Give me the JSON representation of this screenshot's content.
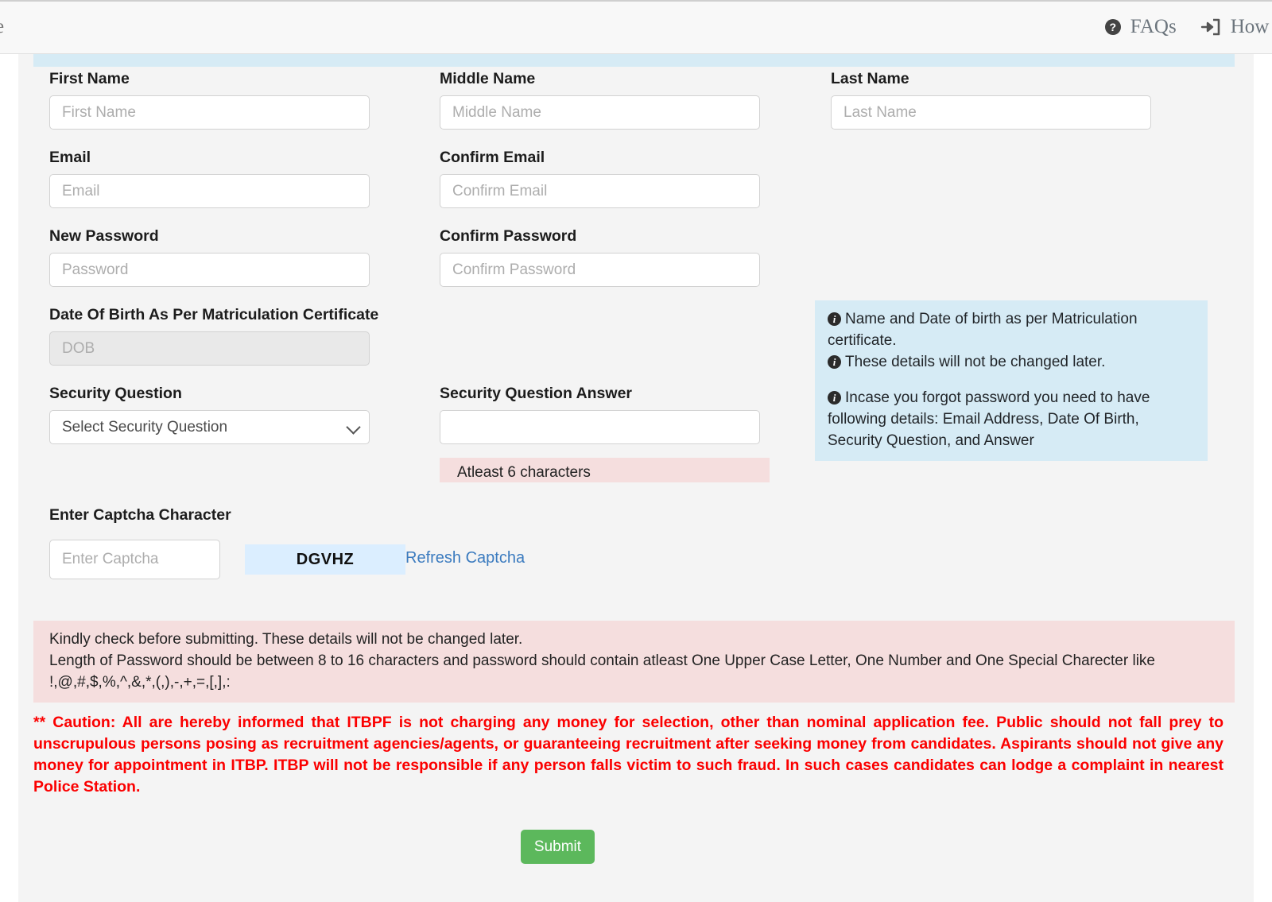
{
  "topbar": {
    "cut_text": "e",
    "links": [
      {
        "label": "FAQs",
        "icon": "question-circle-icon",
        "glyph": "?"
      },
      {
        "label": "How   to",
        "icon": "sign-in-icon",
        "glyph": ""
      }
    ]
  },
  "form": {
    "fields": [
      {
        "key": "first_name",
        "label": "First Name",
        "placeholder": "First Name",
        "value": "",
        "type": "text",
        "disabled": false
      },
      {
        "key": "middle_name",
        "label": "Middle Name",
        "placeholder": "Middle Name",
        "value": "",
        "type": "text",
        "disabled": false
      },
      {
        "key": "last_name",
        "label": "Last Name",
        "placeholder": "Last Name",
        "value": "",
        "type": "text",
        "disabled": false
      },
      {
        "key": "email",
        "label": "Email",
        "placeholder": "Email",
        "value": "",
        "type": "text",
        "disabled": false
      },
      {
        "key": "confirm_email",
        "label": "Confirm Email",
        "placeholder": "Confirm Email",
        "value": "",
        "type": "text",
        "disabled": false
      },
      {
        "key": "new_password",
        "label": "New Password",
        "placeholder": "Password",
        "value": "",
        "type": "password",
        "disabled": false
      },
      {
        "key": "confirm_password",
        "label": "Confirm Password",
        "placeholder": "Confirm Password",
        "value": "",
        "type": "password",
        "disabled": false
      },
      {
        "key": "dob",
        "label": "Date Of Birth As Per Matriculation Certificate",
        "placeholder": "DOB",
        "value": "",
        "type": "text",
        "disabled": true
      },
      {
        "key": "security_question",
        "label": "Security Question",
        "placeholder": "",
        "value": "Select Security Question",
        "type": "select",
        "disabled": false
      },
      {
        "key": "security_answer",
        "label": "Security Question Answer",
        "placeholder": "",
        "value": "",
        "type": "text",
        "disabled": false
      }
    ],
    "security_question_options": [
      "Select Security Question"
    ],
    "answer_hint": "Atleast 6 characters",
    "captcha_label": "Enter Captcha Character",
    "captcha_placeholder": "Enter Captcha",
    "captcha_value": "",
    "captcha_text": "DGVHZ",
    "refresh_captcha_label": "Refresh Captcha"
  },
  "info_boxes": [
    {
      "key": "name-dob-info",
      "lines": [
        "Name and Date of birth as per Matriculation certificate.",
        "These details will not be changed later."
      ]
    },
    {
      "key": "forgot-password-info",
      "lines": [
        "Incase you forgot password you need to have following details: Email Address, Date Of Birth, Security Question, and Answer"
      ]
    }
  ],
  "alerts": {
    "password_rules": [
      "Kindly check before submitting. These details will not be changed later.",
      "Length of Password should be between 8 to 16 characters and password should contain atleast One Upper Case Letter, One Number and One Special Charecter like",
      "!,@,#,$,%,^,&,*,(,),-,+,=,[,],:"
    ],
    "caution": "** Caution: All are hereby informed that ITBPF is not charging any money for selection, other than nominal application fee. Public should not fall prey to unscrupulous persons posing as recruitment agencies/agents, or guaranteeing recruitment after seeking money from candidates. Aspirants should not give any money for appointment in ITBP. ITBP will not be responsible if any person falls victim to such fraud. In such cases candidates can lodge a complaint in nearest Police Station."
  },
  "actions": {
    "submit_label": "Submit"
  },
  "colors": {
    "page_bg": "#f4f4f4",
    "info_blue": "#d6ebf5",
    "alert_pink": "#f5dede",
    "caution_red": "#fb0000",
    "submit_green": "#5cb85c",
    "link_blue": "#3b7bbf",
    "captcha_blue": "#dbeeff"
  }
}
